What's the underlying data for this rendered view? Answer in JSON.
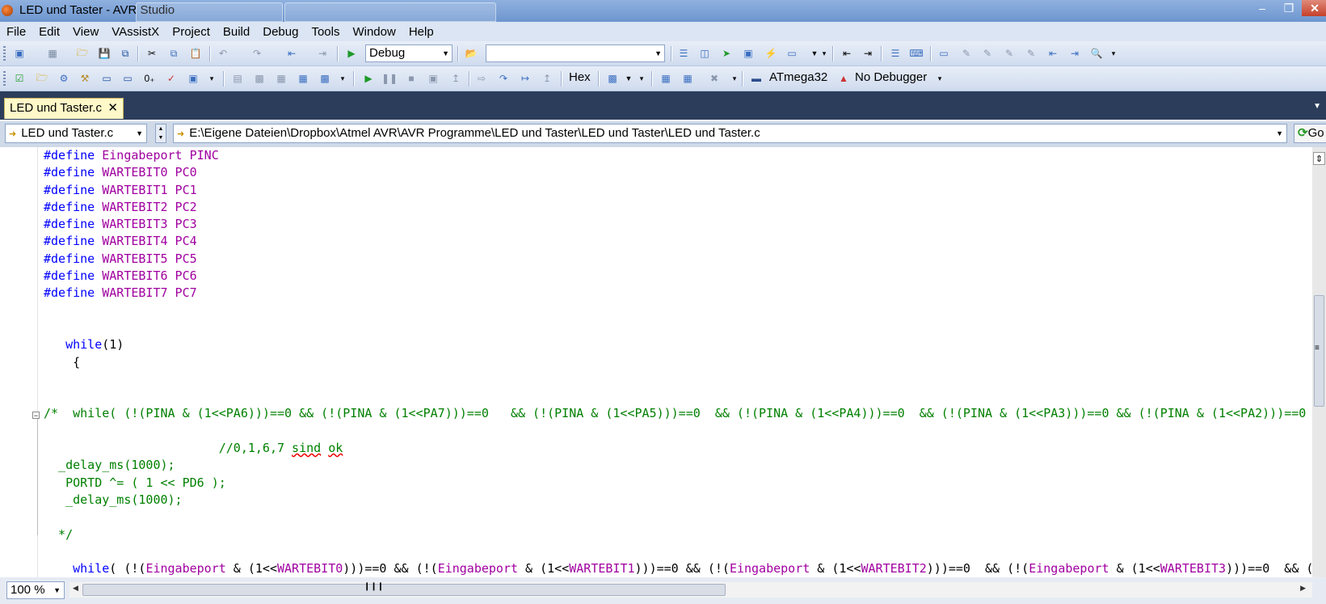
{
  "window": {
    "title": "LED und Taster - AVR Studio"
  },
  "menu": [
    "File",
    "Edit",
    "View",
    "VAssistX",
    "Project",
    "Build",
    "Debug",
    "Tools",
    "Window",
    "Help"
  ],
  "toolbar": {
    "config_value": "Debug",
    "find_value": "",
    "hex_label": "Hex",
    "device_label": "ATmega32",
    "debugger_label": "No Debugger"
  },
  "tab": {
    "label": "LED und Taster.c",
    "close_glyph": "✕"
  },
  "navbar": {
    "file_combo": "LED und Taster.c",
    "path": "E:\\Eigene Dateien\\Dropbox\\Atmel AVR\\AVR Programme\\LED und Taster\\LED und Taster\\LED und Taster.c",
    "go_label": "Go"
  },
  "editor": {
    "zoom": "100 %"
  },
  "code_lines": [
    {
      "segments": [
        {
          "t": "#define",
          "c": "kw"
        },
        {
          "t": " "
        },
        {
          "t": "Eingabeport PINC",
          "c": "mac"
        }
      ]
    },
    {
      "segments": [
        {
          "t": "#define",
          "c": "kw"
        },
        {
          "t": " "
        },
        {
          "t": "WARTEBIT0 PC0",
          "c": "mac"
        }
      ]
    },
    {
      "segments": [
        {
          "t": "#define",
          "c": "kw"
        },
        {
          "t": " "
        },
        {
          "t": "WARTEBIT1 PC1",
          "c": "mac"
        }
      ]
    },
    {
      "segments": [
        {
          "t": "#define",
          "c": "kw"
        },
        {
          "t": " "
        },
        {
          "t": "WARTEBIT2 PC2",
          "c": "mac"
        }
      ]
    },
    {
      "segments": [
        {
          "t": "#define",
          "c": "kw"
        },
        {
          "t": " "
        },
        {
          "t": "WARTEBIT3 PC3",
          "c": "mac"
        }
      ]
    },
    {
      "segments": [
        {
          "t": "#define",
          "c": "kw"
        },
        {
          "t": " "
        },
        {
          "t": "WARTEBIT4 PC4",
          "c": "mac"
        }
      ]
    },
    {
      "segments": [
        {
          "t": "#define",
          "c": "kw"
        },
        {
          "t": " "
        },
        {
          "t": "WARTEBIT5 PC5",
          "c": "mac"
        }
      ]
    },
    {
      "segments": [
        {
          "t": "#define",
          "c": "kw"
        },
        {
          "t": " "
        },
        {
          "t": "WARTEBIT6 PC6",
          "c": "mac"
        }
      ]
    },
    {
      "segments": [
        {
          "t": "#define",
          "c": "kw"
        },
        {
          "t": " "
        },
        {
          "t": "WARTEBIT7 PC7",
          "c": "mac"
        }
      ]
    },
    {
      "segments": []
    },
    {
      "segments": []
    },
    {
      "segments": [
        {
          "t": "   "
        },
        {
          "t": "while",
          "c": "kw"
        },
        {
          "t": "(1)"
        }
      ]
    },
    {
      "segments": [
        {
          "t": "    {"
        }
      ]
    },
    {
      "segments": []
    },
    {
      "segments": []
    },
    {
      "segments": [
        {
          "t": "/*  while( (!(PINA & (1<<PA6)))==0 && (!(PINA & (1<<PA7)))==0   && (!(PINA & (1<<PA5)))==0  && (!(PINA & (1<<PA4)))==0  && (!(PINA & (1<<PA3)))==0 && (!(PINA & (1<<PA2)))==0",
          "c": "cm"
        }
      ]
    },
    {
      "segments": []
    },
    {
      "segments": [
        {
          "t": "                        //0,1,6,7 ",
          "c": "cm"
        },
        {
          "t": "sind",
          "c": "cm sq"
        },
        {
          "t": " ",
          "c": "cm"
        },
        {
          "t": "ok",
          "c": "cm sq"
        }
      ]
    },
    {
      "segments": [
        {
          "t": "  _delay_ms(1000);",
          "c": "cm"
        }
      ]
    },
    {
      "segments": [
        {
          "t": "   PORTD ^= ( 1 << PD6 );",
          "c": "cm"
        }
      ]
    },
    {
      "segments": [
        {
          "t": "   _delay_ms(1000);",
          "c": "cm"
        }
      ]
    },
    {
      "segments": []
    },
    {
      "segments": [
        {
          "t": "  */",
          "c": "cm"
        }
      ]
    },
    {
      "segments": []
    },
    {
      "segments": [
        {
          "t": "    "
        },
        {
          "t": "while",
          "c": "kw"
        },
        {
          "t": "( (!("
        },
        {
          "t": "Eingabeport",
          "c": "mac"
        },
        {
          "t": " & (1<<"
        },
        {
          "t": "WARTEBIT0",
          "c": "mac"
        },
        {
          "t": ")))==0 && (!("
        },
        {
          "t": "Eingabeport",
          "c": "mac"
        },
        {
          "t": " & (1<<"
        },
        {
          "t": "WARTEBIT1",
          "c": "mac"
        },
        {
          "t": ")))==0 && (!("
        },
        {
          "t": "Eingabeport",
          "c": "mac"
        },
        {
          "t": " & (1<<"
        },
        {
          "t": "WARTEBIT2",
          "c": "mac"
        },
        {
          "t": ")))==0  && (!("
        },
        {
          "t": "Eingabeport",
          "c": "mac"
        },
        {
          "t": " & (1<<"
        },
        {
          "t": "WARTEBIT3",
          "c": "mac"
        },
        {
          "t": ")))==0  && ("
        }
      ]
    }
  ]
}
